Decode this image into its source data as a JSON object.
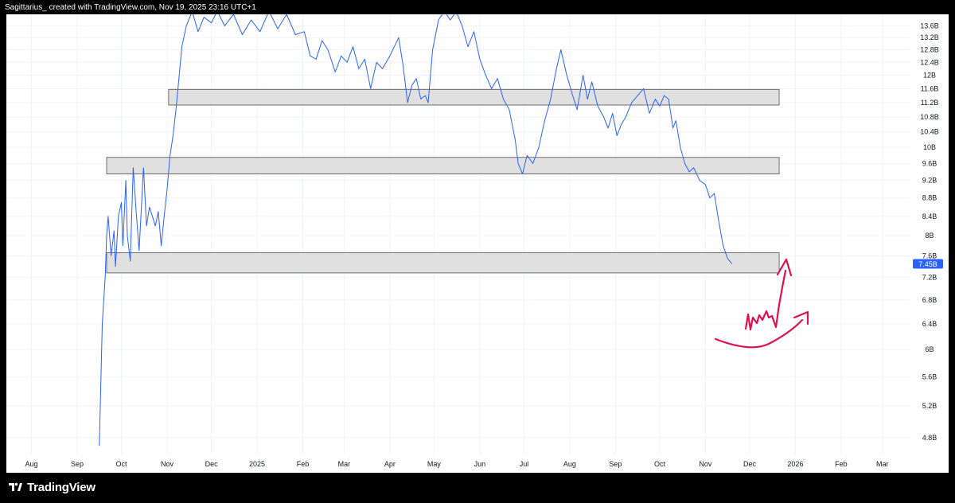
{
  "header": {
    "attribution": "Sagittarius_ created with TradingView.com, Nov 19, 2025 23:16 UTC+1"
  },
  "footer": {
    "brand": "TradingView"
  },
  "colors": {
    "background": "#000000",
    "plot": "#ffffff",
    "price_line": "#2962ff",
    "zone_fill": "#e0e0e0",
    "zone_stroke": "#505050",
    "annotation": "#e0104f",
    "price_badge": "#2962ff",
    "axis_text": "#131722"
  },
  "chart_data": {
    "type": "line",
    "title": "",
    "xlabel": "",
    "ylabel": "",
    "grid": true,
    "y_scale": "log",
    "ylim": [
      4.6,
      14.0
    ],
    "y_ticks": [
      13.6,
      13.2,
      12.8,
      12.4,
      12.0,
      11.6,
      11.2,
      10.8,
      10.4,
      10.0,
      9.6,
      9.2,
      8.8,
      8.4,
      8.0,
      7.6,
      7.2,
      6.8,
      6.4,
      6.0,
      5.6,
      5.2,
      4.8
    ],
    "y_tick_labels": [
      "13.6B",
      "13.2B",
      "12.8B",
      "12.4B",
      "12B",
      "11.6B",
      "11.2B",
      "10.8B",
      "10.4B",
      "10B",
      "9.6B",
      "9.2B",
      "8.8B",
      "8.4B",
      "8B",
      "7.6B",
      "7.2B",
      "6.8B",
      "6.4B",
      "6B",
      "5.6B",
      "5.2B",
      "4.8B"
    ],
    "x_range": [
      "2024-07-15",
      "2026-03-20"
    ],
    "x_ticks": [
      {
        "date": "2024-08-01",
        "label": "Aug"
      },
      {
        "date": "2024-09-01",
        "label": "Sep"
      },
      {
        "date": "2024-10-01",
        "label": "Oct"
      },
      {
        "date": "2024-11-01",
        "label": "Nov"
      },
      {
        "date": "2024-12-01",
        "label": "Dec"
      },
      {
        "date": "2025-01-01",
        "label": "2025"
      },
      {
        "date": "2025-02-01",
        "label": "Feb"
      },
      {
        "date": "2025-03-01",
        "label": "Mar"
      },
      {
        "date": "2025-04-01",
        "label": "Apr"
      },
      {
        "date": "2025-05-01",
        "label": "May"
      },
      {
        "date": "2025-06-01",
        "label": "Jun"
      },
      {
        "date": "2025-07-01",
        "label": "Jul"
      },
      {
        "date": "2025-08-01",
        "label": "Aug"
      },
      {
        "date": "2025-09-01",
        "label": "Sep"
      },
      {
        "date": "2025-10-01",
        "label": "Oct"
      },
      {
        "date": "2025-11-01",
        "label": "Nov"
      },
      {
        "date": "2025-12-01",
        "label": "Dec"
      },
      {
        "date": "2026-01-01",
        "label": "2026"
      },
      {
        "date": "2026-02-01",
        "label": "Feb"
      },
      {
        "date": "2026-03-01",
        "label": "Mar"
      }
    ],
    "series": [
      {
        "points": [
          [
            "2024-09-16",
            4.7
          ],
          [
            "2024-09-18",
            6.4
          ],
          [
            "2024-09-20",
            7.2
          ],
          [
            "2024-09-21",
            8.0
          ],
          [
            "2024-09-22",
            8.4
          ],
          [
            "2024-09-24",
            7.6
          ],
          [
            "2024-09-26",
            8.1
          ],
          [
            "2024-09-27",
            7.4
          ],
          [
            "2024-09-29",
            8.4
          ],
          [
            "2024-10-01",
            8.7
          ],
          [
            "2024-10-02",
            7.8
          ],
          [
            "2024-10-04",
            9.2
          ],
          [
            "2024-10-05",
            8.0
          ],
          [
            "2024-10-07",
            7.5
          ],
          [
            "2024-10-09",
            9.5
          ],
          [
            "2024-10-11",
            8.5
          ],
          [
            "2024-10-13",
            7.7
          ],
          [
            "2024-10-16",
            9.5
          ],
          [
            "2024-10-18",
            8.2
          ],
          [
            "2024-10-20",
            8.6
          ],
          [
            "2024-10-22",
            8.4
          ],
          [
            "2024-10-24",
            8.2
          ],
          [
            "2024-10-26",
            8.5
          ],
          [
            "2024-10-28",
            7.8
          ],
          [
            "2024-10-30",
            8.4
          ],
          [
            "2024-11-01",
            9.0
          ],
          [
            "2024-11-03",
            9.8
          ],
          [
            "2024-11-05",
            10.3
          ],
          [
            "2024-11-07",
            11.0
          ],
          [
            "2024-11-09",
            11.9
          ],
          [
            "2024-11-11",
            12.9
          ],
          [
            "2024-11-14",
            13.6
          ],
          [
            "2024-11-18",
            14.1
          ],
          [
            "2024-11-22",
            13.4
          ],
          [
            "2024-11-26",
            13.9
          ],
          [
            "2024-12-01",
            13.7
          ],
          [
            "2024-12-05",
            14.2
          ],
          [
            "2024-12-10",
            13.6
          ],
          [
            "2024-12-16",
            14.0
          ],
          [
            "2024-12-22",
            13.3
          ],
          [
            "2024-12-28",
            13.8
          ],
          [
            "2025-01-03",
            13.4
          ],
          [
            "2025-01-09",
            14.2
          ],
          [
            "2025-01-15",
            13.5
          ],
          [
            "2025-01-21",
            14.0
          ],
          [
            "2025-01-27",
            13.3
          ],
          [
            "2025-02-02",
            13.4
          ],
          [
            "2025-02-06",
            12.6
          ],
          [
            "2025-02-10",
            12.5
          ],
          [
            "2025-02-14",
            13.1
          ],
          [
            "2025-02-18",
            12.8
          ],
          [
            "2025-02-23",
            12.1
          ],
          [
            "2025-02-27",
            12.6
          ],
          [
            "2025-03-03",
            12.4
          ],
          [
            "2025-03-07",
            12.9
          ],
          [
            "2025-03-11",
            12.2
          ],
          [
            "2025-03-15",
            12.5
          ],
          [
            "2025-03-19",
            11.6
          ],
          [
            "2025-03-23",
            12.4
          ],
          [
            "2025-03-27",
            12.2
          ],
          [
            "2025-04-01",
            12.6
          ],
          [
            "2025-04-04",
            12.9
          ],
          [
            "2025-04-07",
            13.2
          ],
          [
            "2025-04-10",
            12.3
          ],
          [
            "2025-04-13",
            11.2
          ],
          [
            "2025-04-16",
            11.7
          ],
          [
            "2025-04-19",
            11.9
          ],
          [
            "2025-04-22",
            11.3
          ],
          [
            "2025-04-25",
            11.4
          ],
          [
            "2025-04-27",
            11.2
          ],
          [
            "2025-04-30",
            12.8
          ],
          [
            "2025-05-04",
            13.8
          ],
          [
            "2025-05-08",
            14.2
          ],
          [
            "2025-05-12",
            13.8
          ],
          [
            "2025-05-16",
            14.1
          ],
          [
            "2025-05-20",
            13.6
          ],
          [
            "2025-05-24",
            12.9
          ],
          [
            "2025-05-28",
            13.4
          ],
          [
            "2025-06-01",
            12.5
          ],
          [
            "2025-06-05",
            12.0
          ],
          [
            "2025-06-09",
            11.6
          ],
          [
            "2025-06-13",
            11.9
          ],
          [
            "2025-06-17",
            11.3
          ],
          [
            "2025-06-21",
            11.0
          ],
          [
            "2025-06-25",
            10.2
          ],
          [
            "2025-06-27",
            9.6
          ],
          [
            "2025-06-30",
            9.35
          ],
          [
            "2025-07-03",
            9.8
          ],
          [
            "2025-07-07",
            9.6
          ],
          [
            "2025-07-11",
            10.0
          ],
          [
            "2025-07-15",
            10.7
          ],
          [
            "2025-07-19",
            11.3
          ],
          [
            "2025-07-23",
            12.2
          ],
          [
            "2025-07-26",
            12.8
          ],
          [
            "2025-07-30",
            12.0
          ],
          [
            "2025-08-03",
            11.4
          ],
          [
            "2025-08-06",
            11.0
          ],
          [
            "2025-08-10",
            12.0
          ],
          [
            "2025-08-13",
            11.3
          ],
          [
            "2025-08-16",
            11.8
          ],
          [
            "2025-08-20",
            11.1
          ],
          [
            "2025-08-24",
            10.8
          ],
          [
            "2025-08-27",
            10.5
          ],
          [
            "2025-08-30",
            10.9
          ],
          [
            "2025-09-02",
            10.3
          ],
          [
            "2025-09-05",
            10.6
          ],
          [
            "2025-09-08",
            10.8
          ],
          [
            "2025-09-12",
            11.2
          ],
          [
            "2025-09-16",
            11.4
          ],
          [
            "2025-09-20",
            11.6
          ],
          [
            "2025-09-24",
            10.9
          ],
          [
            "2025-09-28",
            11.3
          ],
          [
            "2025-10-01",
            11.1
          ],
          [
            "2025-10-04",
            11.4
          ],
          [
            "2025-10-07",
            11.3
          ],
          [
            "2025-10-10",
            10.5
          ],
          [
            "2025-10-12",
            10.7
          ],
          [
            "2025-10-15",
            10.0
          ],
          [
            "2025-10-18",
            9.6
          ],
          [
            "2025-10-21",
            9.4
          ],
          [
            "2025-10-24",
            9.5
          ],
          [
            "2025-10-28",
            9.2
          ],
          [
            "2025-11-01",
            9.1
          ],
          [
            "2025-11-04",
            8.8
          ],
          [
            "2025-11-07",
            8.9
          ],
          [
            "2025-11-10",
            8.3
          ],
          [
            "2025-11-13",
            7.8
          ],
          [
            "2025-11-16",
            7.55
          ],
          [
            "2025-11-19",
            7.45
          ]
        ]
      }
    ],
    "last_value": 7.45,
    "last_value_label": "7.45B",
    "zones": [
      {
        "start": "2024-11-02",
        "end": "2025-12-21",
        "low": 11.13,
        "high": 11.58
      },
      {
        "start": "2024-09-21",
        "end": "2025-12-21",
        "low": 9.35,
        "high": 9.75
      },
      {
        "start": "2024-09-21",
        "end": "2025-12-21",
        "low": 7.28,
        "high": 7.66
      }
    ]
  }
}
